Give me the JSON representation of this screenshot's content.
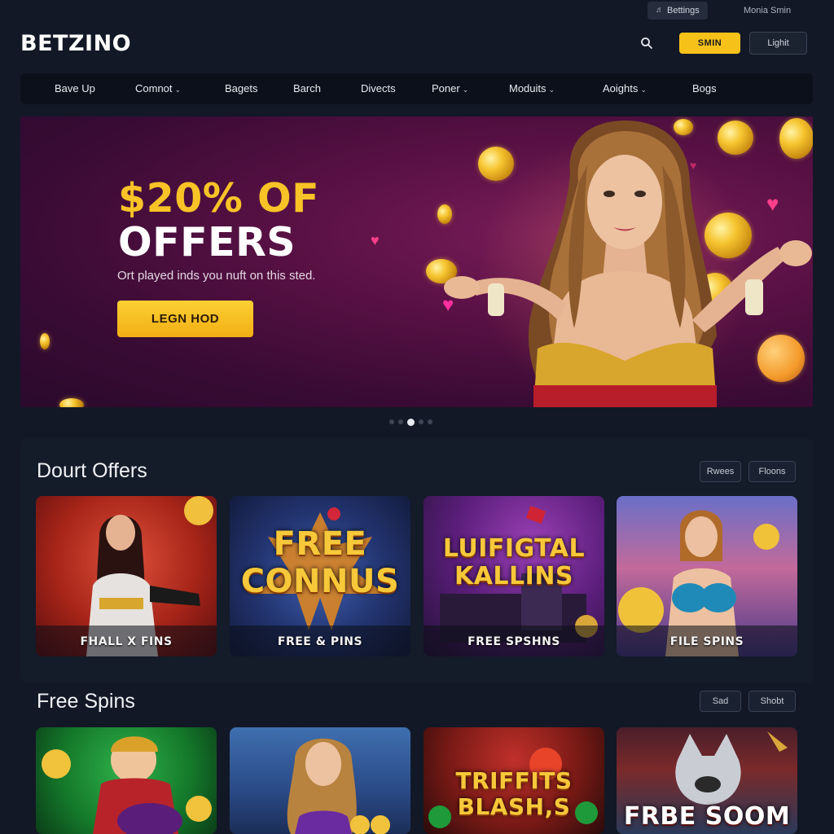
{
  "topbar": {
    "betting_label": "Bettings",
    "account_label": "Monia Smin"
  },
  "header": {
    "logo": "BETZINO",
    "signin_label": "SMIN",
    "login_label": "Lighit"
  },
  "nav": {
    "items": [
      {
        "label": "Bave Up",
        "chevron": false
      },
      {
        "label": "Comnot",
        "chevron": true
      },
      {
        "label": "Bagets",
        "chevron": false
      },
      {
        "label": "Barch",
        "chevron": false
      },
      {
        "label": "Divects",
        "chevron": false
      },
      {
        "label": "Poner",
        "chevron": true
      },
      {
        "label": "Moduits",
        "chevron": true
      },
      {
        "label": "Aoights",
        "chevron": true
      },
      {
        "label": "Bogs",
        "chevron": false
      }
    ]
  },
  "hero": {
    "title_line1": "$20% OF",
    "title_line2": "OFFERS",
    "subtitle": "Ort played inds you nuft on this sted.",
    "cta_label": "LEGN HOD"
  },
  "carousel": {
    "total": 5,
    "active": 3
  },
  "sections": [
    {
      "title": "Dourt Offers",
      "buttons": [
        "Rwees",
        "Floons"
      ],
      "cards": [
        {
          "caption": "FHALL X FINS",
          "overlay": ""
        },
        {
          "caption": "FREE & PINS",
          "overlay": "FREE CONNUS"
        },
        {
          "caption": "FREE SPSHNS",
          "overlay": "LUIFIGTAL KALLINS"
        },
        {
          "caption": "FILE SPINS",
          "overlay": ""
        }
      ]
    },
    {
      "title": "Free Spins",
      "buttons": [
        "Sad",
        "Shobt"
      ],
      "cards": [
        {
          "caption": "",
          "overlay": ""
        },
        {
          "caption": "",
          "overlay": ""
        },
        {
          "caption": "",
          "overlay": "TRIFFITS BLASH,S"
        },
        {
          "caption": "",
          "overlay": "FRBE SOOM"
        }
      ]
    }
  ],
  "colors": {
    "accent": "#f6c21a",
    "background": "#121826",
    "nav": "#0b101b",
    "hero": "#5a1145"
  }
}
